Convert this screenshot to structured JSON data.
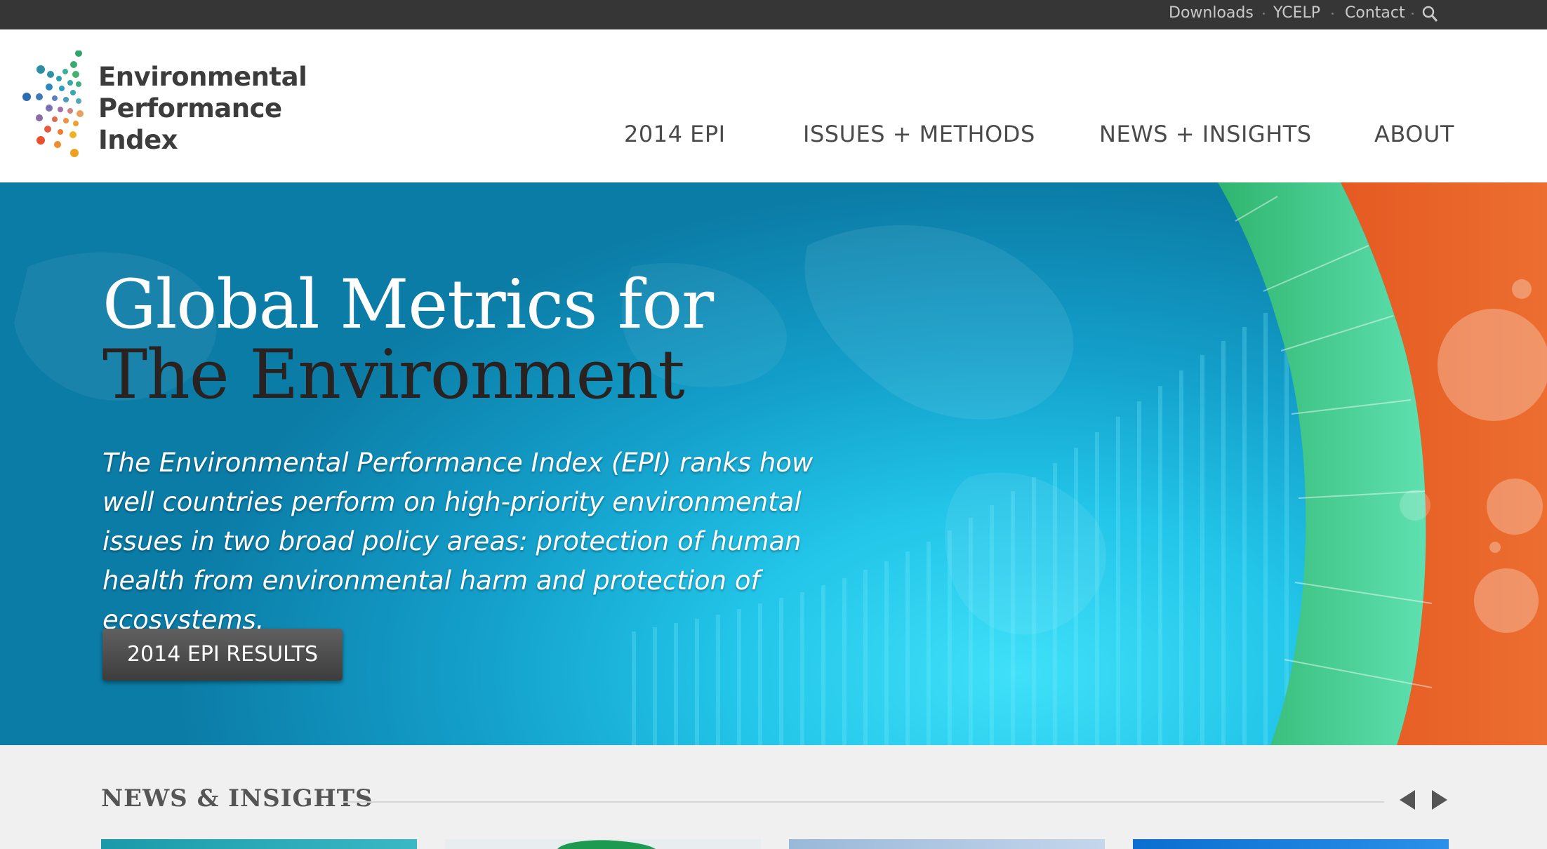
{
  "topbar": {
    "links": [
      "Downloads",
      "YCELP",
      "Contact"
    ],
    "search_icon": "search-icon"
  },
  "logo": {
    "lines": [
      "Environmental",
      "Performance",
      "Index"
    ]
  },
  "nav": {
    "items": [
      "2014 EPI",
      "ISSUES + METHODS",
      "NEWS + INSIGHTS",
      "ABOUT"
    ]
  },
  "hero": {
    "title_line1": "Global Metrics for",
    "title_line2": "The Environment",
    "description": "The Environmental Performance Index (EPI) ranks how well countries perform on high-priority environmental issues in two broad policy areas: protection of human health from environmental harm and protection of ecosystems.",
    "cta_label": "2014 EPI RESULTS"
  },
  "news": {
    "title": "NEWS & INSIGHTS",
    "prev_icon": "triangle-left-icon",
    "next_icon": "triangle-right-icon"
  },
  "colors": {
    "topbar": "#363636",
    "hero_blue": "#22c4e8",
    "green_band": "#3ccf8e",
    "orange_band": "#e8632a"
  }
}
